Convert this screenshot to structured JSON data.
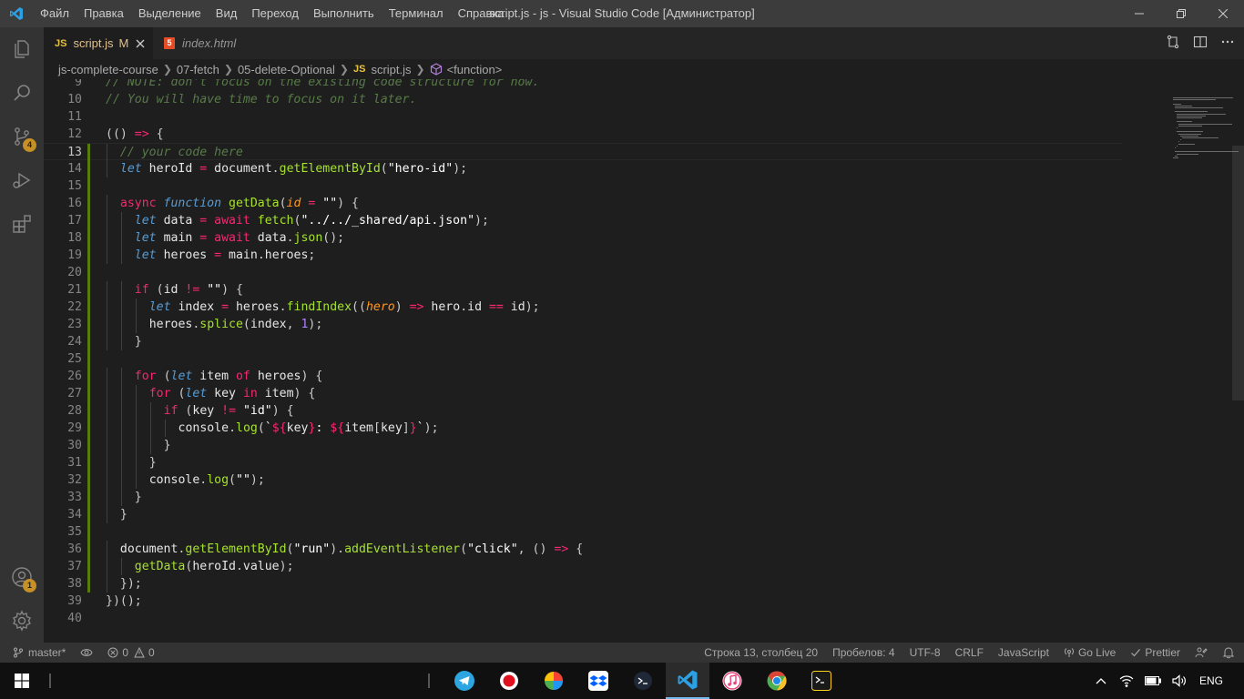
{
  "window": {
    "title": "script.js - js - Visual Studio Code [Администратор]",
    "menu": [
      "Файл",
      "Правка",
      "Выделение",
      "Вид",
      "Переход",
      "Выполнить",
      "Терминал",
      "Справка"
    ]
  },
  "activity_bar": {
    "source_control_badge": "4",
    "accounts_badge": "1",
    "icons": [
      "explorer-icon",
      "search-icon",
      "source-control-icon",
      "run-debug-icon",
      "extensions-icon",
      "accounts-icon",
      "settings-gear-icon"
    ]
  },
  "tabs": [
    {
      "lang_badge": "JS",
      "label": "script.js",
      "status": "M",
      "active": true
    },
    {
      "lang_badge": "5",
      "label": "index.html",
      "active": false
    }
  ],
  "breadcrumb": {
    "parts": [
      "js-complete-course",
      "07-fetch",
      "05-delete-Optional"
    ],
    "file_badge": "JS",
    "file": "script.js",
    "symbol": "<function>"
  },
  "editor": {
    "cursor_line": 13,
    "lines": [
      {
        "n": "9",
        "indent": 0,
        "tokens": [
          [
            "cmt",
            "// NOTE: don't focus on the existing code structure for now."
          ]
        ]
      },
      {
        "n": "10",
        "indent": 0,
        "tokens": [
          [
            "cmt",
            "// You will have time to focus on it later."
          ]
        ]
      },
      {
        "n": "11",
        "indent": 0,
        "tokens": []
      },
      {
        "n": "12",
        "indent": 0,
        "tokens": [
          [
            "pun",
            "(() "
          ],
          [
            "op",
            "=>"
          ],
          [
            "pun",
            " {"
          ]
        ]
      },
      {
        "n": "13",
        "indent": 1,
        "tokens": [
          [
            "cmt",
            "// your code here"
          ]
        ]
      },
      {
        "n": "14",
        "indent": 1,
        "tokens": [
          [
            "kw",
            "let"
          ],
          [
            "var",
            " heroId "
          ],
          [
            "op",
            "="
          ],
          [
            "var",
            " document"
          ],
          [
            "pun",
            "."
          ],
          [
            "fn",
            "getElementById"
          ],
          [
            "pun",
            "("
          ],
          [
            "str",
            "\"hero-id\""
          ],
          [
            "pun",
            ");"
          ]
        ]
      },
      {
        "n": "15",
        "indent": 0,
        "tokens": []
      },
      {
        "n": "16",
        "indent": 1,
        "tokens": [
          [
            "ctl",
            "async"
          ],
          [
            "kw",
            " function"
          ],
          [
            "fn",
            " getData"
          ],
          [
            "pun",
            "("
          ],
          [
            "par",
            "id"
          ],
          [
            "op",
            " ="
          ],
          [
            "str",
            " \"\""
          ],
          [
            "pun",
            ") {"
          ]
        ]
      },
      {
        "n": "17",
        "indent": 2,
        "tokens": [
          [
            "kw",
            "let"
          ],
          [
            "var",
            " data "
          ],
          [
            "op",
            "="
          ],
          [
            "ctl",
            " await"
          ],
          [
            "fn",
            " fetch"
          ],
          [
            "pun",
            "("
          ],
          [
            "str",
            "\"../../_shared/api.json\""
          ],
          [
            "pun",
            ");"
          ]
        ]
      },
      {
        "n": "18",
        "indent": 2,
        "tokens": [
          [
            "kw",
            "let"
          ],
          [
            "var",
            " main "
          ],
          [
            "op",
            "="
          ],
          [
            "ctl",
            " await"
          ],
          [
            "var",
            " data"
          ],
          [
            "pun",
            "."
          ],
          [
            "fn",
            "json"
          ],
          [
            "pun",
            "();"
          ]
        ]
      },
      {
        "n": "19",
        "indent": 2,
        "tokens": [
          [
            "kw",
            "let"
          ],
          [
            "var",
            " heroes "
          ],
          [
            "op",
            "="
          ],
          [
            "var",
            " main"
          ],
          [
            "pun",
            "."
          ],
          [
            "var",
            "heroes"
          ],
          [
            "pun",
            ";"
          ]
        ]
      },
      {
        "n": "20",
        "indent": 0,
        "tokens": []
      },
      {
        "n": "21",
        "indent": 2,
        "tokens": [
          [
            "ctl",
            "if"
          ],
          [
            "pun",
            " ("
          ],
          [
            "var",
            "id"
          ],
          [
            "op",
            " !="
          ],
          [
            "str",
            " \"\""
          ],
          [
            "pun",
            ") {"
          ]
        ]
      },
      {
        "n": "22",
        "indent": 3,
        "tokens": [
          [
            "kw",
            "let"
          ],
          [
            "var",
            " index "
          ],
          [
            "op",
            "="
          ],
          [
            "var",
            " heroes"
          ],
          [
            "pun",
            "."
          ],
          [
            "fn",
            "findIndex"
          ],
          [
            "pun",
            "(("
          ],
          [
            "par",
            "hero"
          ],
          [
            "pun",
            ") "
          ],
          [
            "op",
            "=>"
          ],
          [
            "var",
            " hero"
          ],
          [
            "pun",
            "."
          ],
          [
            "var",
            "id"
          ],
          [
            "op",
            " =="
          ],
          [
            "var",
            " id"
          ],
          [
            "pun",
            ");"
          ]
        ]
      },
      {
        "n": "23",
        "indent": 3,
        "tokens": [
          [
            "var",
            "heroes"
          ],
          [
            "pun",
            "."
          ],
          [
            "fn",
            "splice"
          ],
          [
            "pun",
            "("
          ],
          [
            "var",
            "index"
          ],
          [
            "pun",
            ", "
          ],
          [
            "num",
            "1"
          ],
          [
            "pun",
            ");"
          ]
        ]
      },
      {
        "n": "24",
        "indent": 2,
        "tokens": [
          [
            "pun",
            "}"
          ]
        ]
      },
      {
        "n": "25",
        "indent": 0,
        "tokens": []
      },
      {
        "n": "26",
        "indent": 2,
        "tokens": [
          [
            "ctl",
            "for"
          ],
          [
            "pun",
            " ("
          ],
          [
            "kw",
            "let"
          ],
          [
            "var",
            " item "
          ],
          [
            "ctl",
            "of"
          ],
          [
            "var",
            " heroes"
          ],
          [
            "pun",
            ") {"
          ]
        ]
      },
      {
        "n": "27",
        "indent": 3,
        "tokens": [
          [
            "ctl",
            "for"
          ],
          [
            "pun",
            " ("
          ],
          [
            "kw",
            "let"
          ],
          [
            "var",
            " key "
          ],
          [
            "ctl",
            "in"
          ],
          [
            "var",
            " item"
          ],
          [
            "pun",
            ") {"
          ]
        ]
      },
      {
        "n": "28",
        "indent": 4,
        "tokens": [
          [
            "ctl",
            "if"
          ],
          [
            "pun",
            " ("
          ],
          [
            "var",
            "key"
          ],
          [
            "op",
            " !="
          ],
          [
            "str",
            " \"id\""
          ],
          [
            "pun",
            ") {"
          ]
        ]
      },
      {
        "n": "29",
        "indent": 5,
        "tokens": [
          [
            "var",
            "console"
          ],
          [
            "pun",
            "."
          ],
          [
            "fn",
            "log"
          ],
          [
            "pun",
            "("
          ],
          [
            "str",
            "`"
          ],
          [
            "op",
            "${"
          ],
          [
            "var",
            "key"
          ],
          [
            "op",
            "}"
          ],
          [
            "str",
            ": "
          ],
          [
            "op",
            "${"
          ],
          [
            "var",
            "item"
          ],
          [
            "pun",
            "["
          ],
          [
            "var",
            "key"
          ],
          [
            "pun",
            "]"
          ],
          [
            "op",
            "}"
          ],
          [
            "str",
            "`"
          ],
          [
            "pun",
            ");"
          ]
        ]
      },
      {
        "n": "30",
        "indent": 4,
        "tokens": [
          [
            "pun",
            "}"
          ]
        ]
      },
      {
        "n": "31",
        "indent": 3,
        "tokens": [
          [
            "pun",
            "}"
          ]
        ]
      },
      {
        "n": "32",
        "indent": 3,
        "tokens": [
          [
            "var",
            "console"
          ],
          [
            "pun",
            "."
          ],
          [
            "fn",
            "log"
          ],
          [
            "pun",
            "("
          ],
          [
            "str",
            "\"\""
          ],
          [
            "pun",
            ");"
          ]
        ]
      },
      {
        "n": "33",
        "indent": 2,
        "tokens": [
          [
            "pun",
            "}"
          ]
        ]
      },
      {
        "n": "34",
        "indent": 1,
        "tokens": [
          [
            "pun",
            "}"
          ]
        ]
      },
      {
        "n": "35",
        "indent": 0,
        "tokens": []
      },
      {
        "n": "36",
        "indent": 1,
        "tokens": [
          [
            "var",
            "document"
          ],
          [
            "pun",
            "."
          ],
          [
            "fn",
            "getElementById"
          ],
          [
            "pun",
            "("
          ],
          [
            "str",
            "\"run\""
          ],
          [
            "pun",
            ")."
          ],
          [
            "fn",
            "addEventListener"
          ],
          [
            "pun",
            "("
          ],
          [
            "str",
            "\"click\""
          ],
          [
            "pun",
            ", () "
          ],
          [
            "op",
            "=>"
          ],
          [
            "pun",
            " {"
          ]
        ]
      },
      {
        "n": "37",
        "indent": 2,
        "tokens": [
          [
            "fn",
            "getData"
          ],
          [
            "pun",
            "("
          ],
          [
            "var",
            "heroId"
          ],
          [
            "pun",
            "."
          ],
          [
            "var",
            "value"
          ],
          [
            "pun",
            ");"
          ]
        ]
      },
      {
        "n": "38",
        "indent": 1,
        "tokens": [
          [
            "pun",
            "});"
          ]
        ]
      },
      {
        "n": "39",
        "indent": 0,
        "tokens": [
          [
            "pun",
            "})();"
          ]
        ]
      },
      {
        "n": "40",
        "indent": 0,
        "tokens": []
      }
    ]
  },
  "status_bar": {
    "branch": "master*",
    "errors": "0",
    "warnings": "0",
    "cursor_position": "Строка 13, столбец 20",
    "indentation": "Пробелов: 4",
    "encoding": "UTF-8",
    "eol": "CRLF",
    "language": "JavaScript",
    "live_server": "Go Live",
    "formatter": "Prettier"
  },
  "taskbar": {
    "apps": [
      "telegram-icon",
      "record-icon",
      "color-picker-icon",
      "dropbox-icon",
      "terminal-icon",
      "vscode-icon",
      "itunes-icon",
      "chrome-icon",
      "windows-terminal-icon"
    ],
    "language": "ENG"
  },
  "colors": {
    "accent": "#007acc",
    "badge": "#c69026",
    "modified_gutter": "#587c0c"
  }
}
